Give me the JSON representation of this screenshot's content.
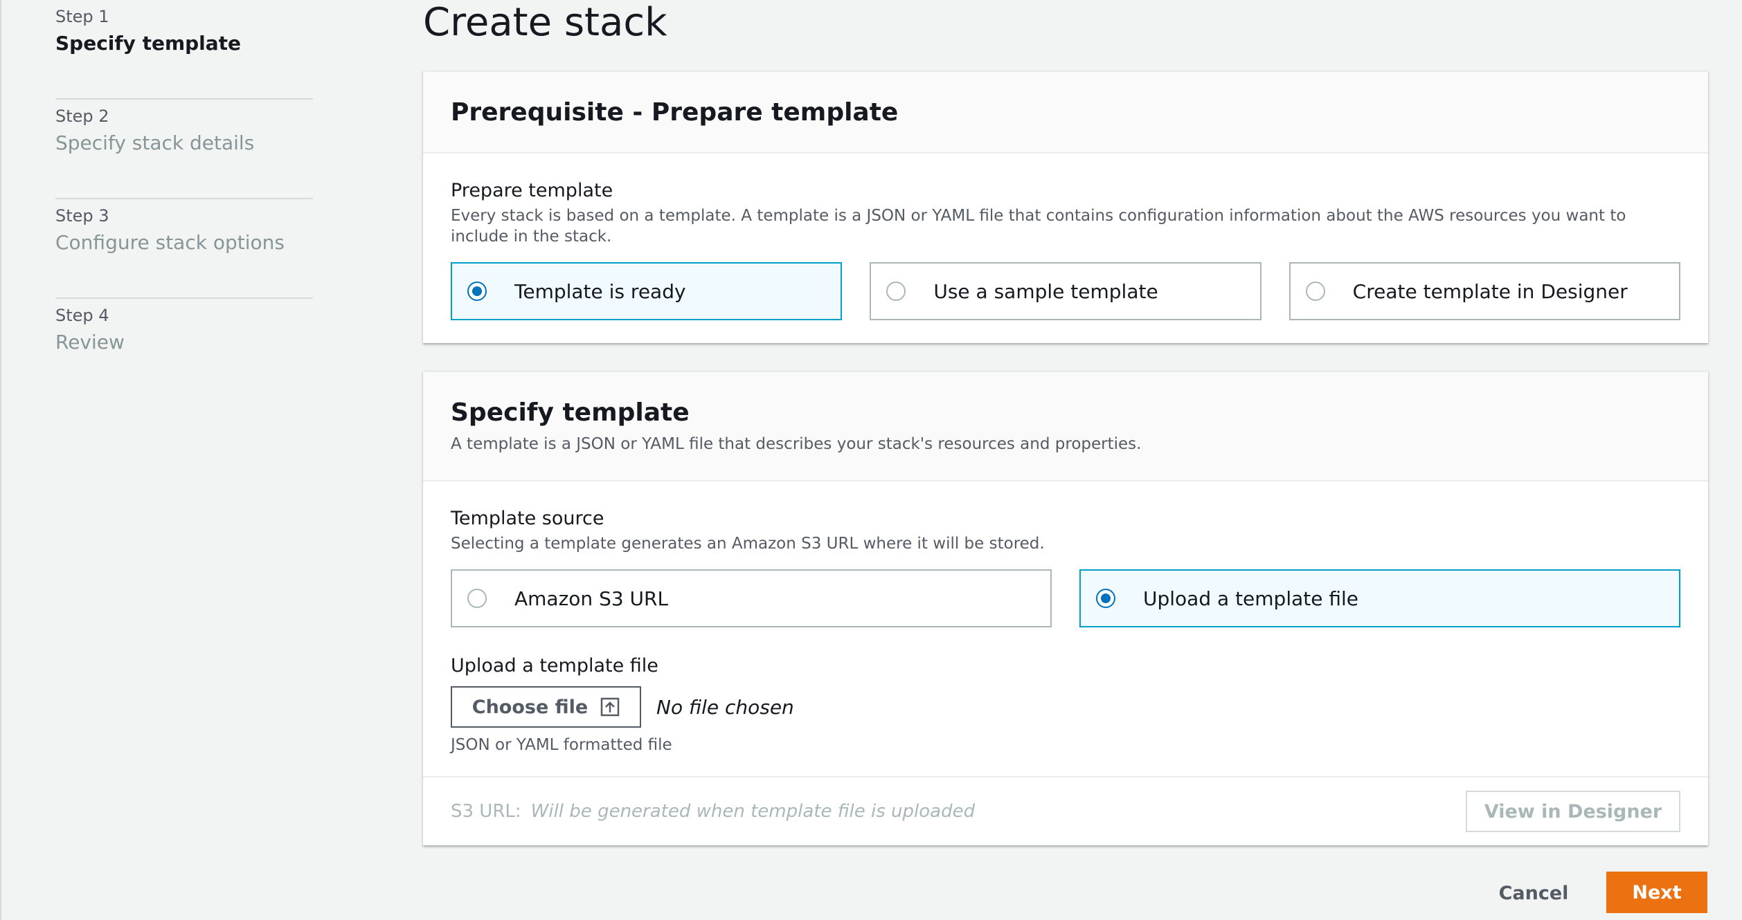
{
  "steps": [
    {
      "number": "Step 1",
      "title": "Specify template",
      "active": true
    },
    {
      "number": "Step 2",
      "title": "Specify stack details",
      "active": false
    },
    {
      "number": "Step 3",
      "title": "Configure stack options",
      "active": false
    },
    {
      "number": "Step 4",
      "title": "Review",
      "active": false
    }
  ],
  "page": {
    "title": "Create stack"
  },
  "prerequisite": {
    "header": "Prerequisite - Prepare template",
    "field_label": "Prepare template",
    "field_desc": "Every stack is based on a template. A template is a JSON or YAML file that contains configuration information about the AWS resources you want to include in the stack.",
    "options": [
      {
        "label": "Template is ready",
        "selected": true
      },
      {
        "label": "Use a sample template",
        "selected": false
      },
      {
        "label": "Create template in Designer",
        "selected": false
      }
    ]
  },
  "specify": {
    "header": "Specify template",
    "header_desc": "A template is a JSON or YAML file that describes your stack's resources and properties.",
    "source_label": "Template source",
    "source_desc": "Selecting a template generates an Amazon S3 URL where it will be stored.",
    "options": [
      {
        "label": "Amazon S3 URL",
        "selected": false
      },
      {
        "label": "Upload a template file",
        "selected": true
      }
    ],
    "upload_label": "Upload a template file",
    "choose_file_label": "Choose file",
    "no_file_text": "No file chosen",
    "upload_hint": "JSON or YAML formatted file",
    "s3_label": "S3 URL:",
    "s3_value": "Will be generated when template file is uploaded",
    "view_designer_label": "View in Designer"
  },
  "footer": {
    "cancel_label": "Cancel",
    "next_label": "Next"
  },
  "colors": {
    "accent": "#0073bb",
    "primary_button": "#ec7211",
    "selected_tile": "#f1faff",
    "selected_border": "#00a1c9"
  }
}
